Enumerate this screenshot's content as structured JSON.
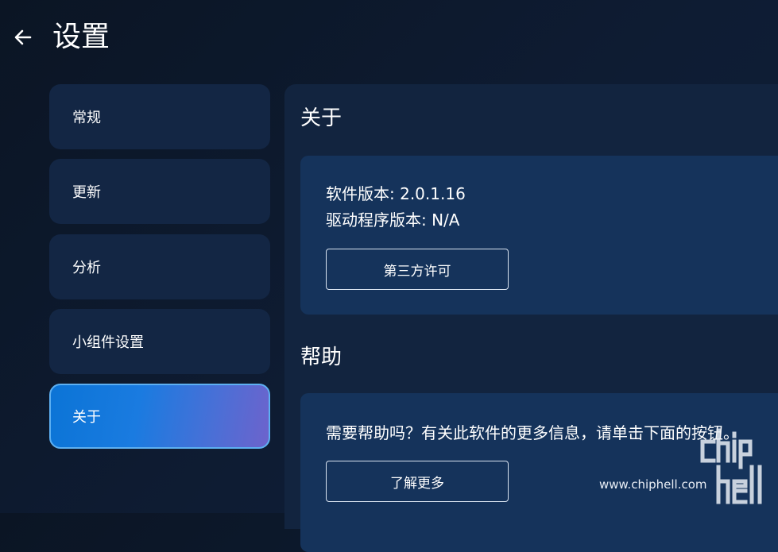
{
  "header": {
    "title": "设置",
    "back_icon": "arrow-left-icon"
  },
  "sidebar": {
    "items": [
      {
        "label": "常规",
        "active": false
      },
      {
        "label": "更新",
        "active": false
      },
      {
        "label": "分析",
        "active": false
      },
      {
        "label": "小组件设置",
        "active": false
      },
      {
        "label": "关于",
        "active": true
      }
    ]
  },
  "about": {
    "title": "关于",
    "software_version": "软件版本: 2.0.1.16",
    "driver_version": "驱动程序版本: N/A",
    "license_button": "第三方许可"
  },
  "help": {
    "title": "帮助",
    "description": "需要帮助吗？有关此软件的更多信息，请单击下面的按钮。",
    "learn_more_button": "了解更多"
  },
  "watermark": {
    "text": "www.chiphell.com",
    "logo": "chiphell"
  },
  "colors": {
    "background": "#0b1524",
    "panel": "#12243f",
    "card": "#15335b",
    "nav_item": "#132644",
    "active_gradient_start": "#0b74d6",
    "active_gradient_end": "#6d63cc",
    "active_border": "#5db0f2"
  }
}
